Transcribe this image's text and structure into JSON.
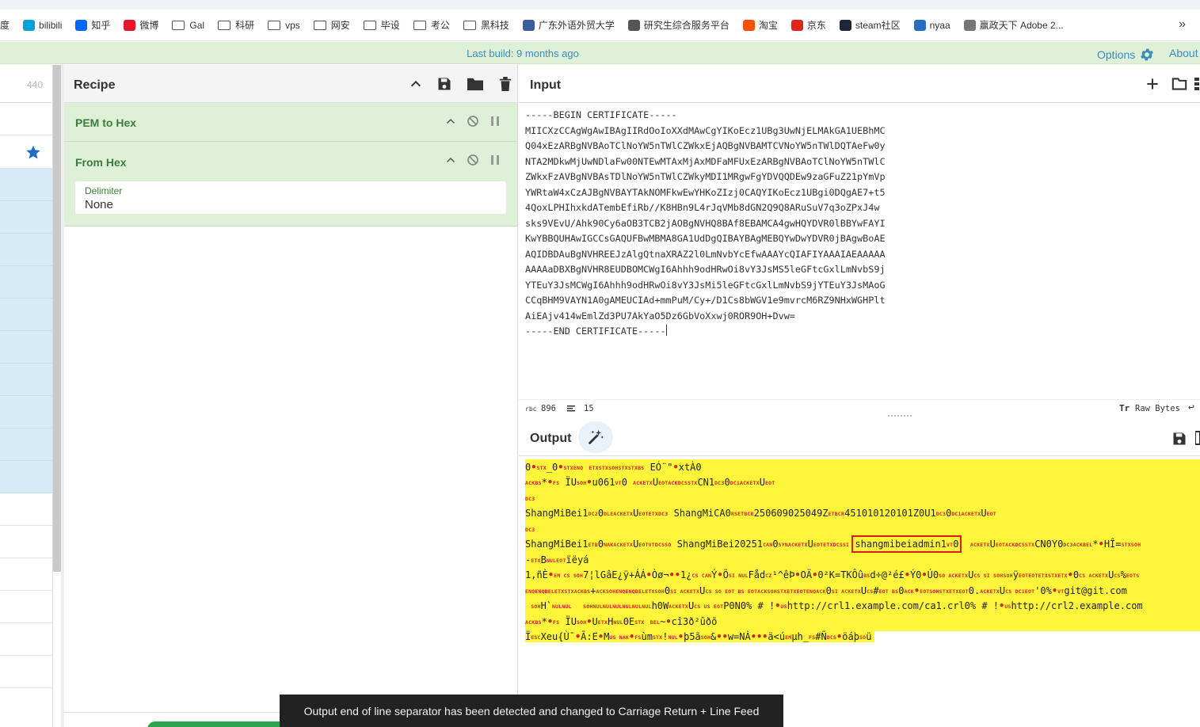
{
  "bookmarks": [
    {
      "label": "度",
      "icon": "",
      "color": ""
    },
    {
      "label": "bilibili",
      "icon": "bilibili-icon",
      "color": "#00a1d6"
    },
    {
      "label": "知乎",
      "icon": "zhihu-icon",
      "color": "#0066ff"
    },
    {
      "label": "微博",
      "icon": "weibo-icon",
      "color": "#e6162d"
    },
    {
      "label": "Gal",
      "icon": "folder-icon",
      "color": ""
    },
    {
      "label": "科研",
      "icon": "folder-icon",
      "color": ""
    },
    {
      "label": "vps",
      "icon": "folder-icon",
      "color": ""
    },
    {
      "label": "网安",
      "icon": "folder-icon",
      "color": ""
    },
    {
      "label": "毕设",
      "icon": "folder-icon",
      "color": ""
    },
    {
      "label": "考公",
      "icon": "folder-icon",
      "color": ""
    },
    {
      "label": "黑科技",
      "icon": "folder-icon",
      "color": ""
    },
    {
      "label": "广东外语外贸大学",
      "icon": "university-icon",
      "color": "#3a5ba0"
    },
    {
      "label": "研究生综合服务平台",
      "icon": "globe-icon",
      "color": "#555555"
    },
    {
      "label": "淘宝",
      "icon": "taobao-icon",
      "color": "#ff5000"
    },
    {
      "label": "京东",
      "icon": "jd-icon",
      "color": "#e1251b"
    },
    {
      "label": "steam社区",
      "icon": "steam-icon",
      "color": "#1b2838"
    },
    {
      "label": "nyaa",
      "icon": "nyaa-icon",
      "color": "#2a6cc0"
    },
    {
      "label": "赢政天下 Adobe 2...",
      "icon": "leaf-icon",
      "color": "#777777"
    }
  ],
  "bookmarks_more": "»",
  "banner": {
    "build": "Last build: 9 months ago",
    "options": "Options",
    "about": "About"
  },
  "ops": {
    "count": "440"
  },
  "recipe": {
    "title": "Recipe",
    "operations": [
      {
        "name": "PEM to Hex"
      },
      {
        "name": "From Hex",
        "arg_label": "Delimiter",
        "arg_value": "None"
      }
    ]
  },
  "input": {
    "title": "Input",
    "lines": [
      "-----BEGIN CERTIFICATE-----",
      "MIICXzCCAgWgAwIBAgIIRdOoIoXXdMAwCgYIKoEcz1UBg3UwNjELMAkGA1UEBhMC",
      "Q04xEzARBgNVBAoTClNoYW5nTWlCZWkxEjAQBgNVBAMTCVNoYW5nTWlDQTAeFw0y",
      "NTA2MDkwMjUwNDlaFw00NTEwMTAxMjAxMDFaMFUxEzARBgNVBAoTClNoYW5nTWlC",
      "ZWkxFzAVBgNVBAsTDlNoYW5nTWlCZWkyMDI1MRgwFgYDVQQDEw9zaGFuZ21pYmVp",
      "YWRtaW4xCzAJBgNVBAYTAkNOMFkwEwYHKoZIzj0CAQYIKoEcz1UBgi0DQgAE7+t5",
      "4QoxLPHIhxkdATembEfiRb//K8HBn9L4rJqVMb8dGN2Q9Q8ARuSuV7q3oZPxJ4w",
      "sks9VEvU/Ahk90Cy6aOB3TCB2jAOBgNVHQ8BAf8EBAMCA4gwHQYDVR0lBBYwFAYI",
      "KwYBBQUHAwIGCCsGAQUFBwMBMA8GA1UdDgQIBAYBAgMEBQYwDwYDVR0jBAgwBoAE",
      "AQIDBDAuBgNVHREEJzAlgQtnaXRAZ2l0LmNvbYcEfwAAAYcQIAFIYAAAIAEAAAAA",
      "AAAAaDBXBgNVHR8EUDBOMCWgI6Ahhh9odHRwOi8vY3JsMS5leGFtcGxlLmNvbS9j",
      "YTEuY3JsMCWgI6Ahhh9odHRwOi8vY3JsMi5leGFtcGxlLmNvbS9jYTEuY3JsMAoG",
      "CCqBHM9VAYN1A0gAMEUCIAd+mmPuM/Cy+/D1Cs8bWGV1e9mvrcM6RZ9NHxWGHPlt",
      "AiEAjv414wEmlZd3PU7AkYaO5Dz6GbVoXxwj0ROR9OH+Dvw=",
      "-----END CERTIFICATE-----"
    ],
    "status_chars": "896",
    "status_lines": "15",
    "raw_bytes": "Raw Bytes"
  },
  "output": {
    "title": "Output",
    "highlight_text": "shangmibeiadmin1",
    "line1": "0•STX_0•STXENQ ETXSTXSOHSTXSTXBS EÓ¨\"•xtÀ0",
    "line2": "ACKBS*•FS ÏUSOH•u061VT0 ACKETXUEOTACKDCSSTXCN1DC30DC1ACKETXUEOT",
    "line3": "DC3",
    "line4": "ShangMiBei1DC20DLEACKETXUEOTETXDC3 ShangMiCA0RSETBCR2506090250492ETBCR451010120101Z0U1DC30DC1ACKETXUEOT",
    "line5": "DC3",
    "line6a": "ShangMiBei1ETB0NAKACKETXUEOTVTDCSSO ShangMiBei20251CAN0SYNACKETXUEOTETXDCSSI",
    "line6b": "VT0 ACKETXUEOTACKDCSSTXCN0Y0DC3ACKBEL*•HÎ=STXSOH",
    "line7": "-ETXBNULEOTïëyá",
    "line8": "1,ñÈ•EMCSSOH7¦lGâE¿ÿ+ÁÁ•Òø¬••1¿CSCANÝ•ÕSINULFåDCZ¹^êÞ•OÄ•0²K=TKÔûBSd÷@²é£•Ý0•Ú0SOACKETXUCSSISOHSOHÿEOTEOTETXSTXETX•0CSACKETXUCS%EOTS",
    "line9": "ENQENQBELETXSTXACKBS+ACKSOHENQENQBELETXSOH0SIACKETXUCSSOEOTBSEOTACKSOHSTXETXEOTENQACK0SIACKETXUCS#EOTBS0ACK•EOTSOHSTXETXEOT0.ACKETXUCSDC1EOT'0%•VTgit@git.com",
    "line10": "SOHH`NULNUL SOHNULNULNULNULNULNULh0WACKETXUCSUSEOTP0N0% # !•USCShttp://crl1.example.com/ca1.crl0% # !•UShttp://crl2.example.com",
    "line11": "ACKBS*•FS ÏUSOH•UETXHNUL0ESTX BEL~•cî3ð²ûðõ",
    "line12": "ÏESCXeu{Ù¯•Ã:E•MUSNAK•FSùmSTX!NUL•þ5ãSOH&••w=NÀ•••ä<úEMµh_FS#ÑDCS•öáþSOü"
  },
  "toast": "Output end of line separator has been detected and changed to Carriage Return + Line Feed"
}
